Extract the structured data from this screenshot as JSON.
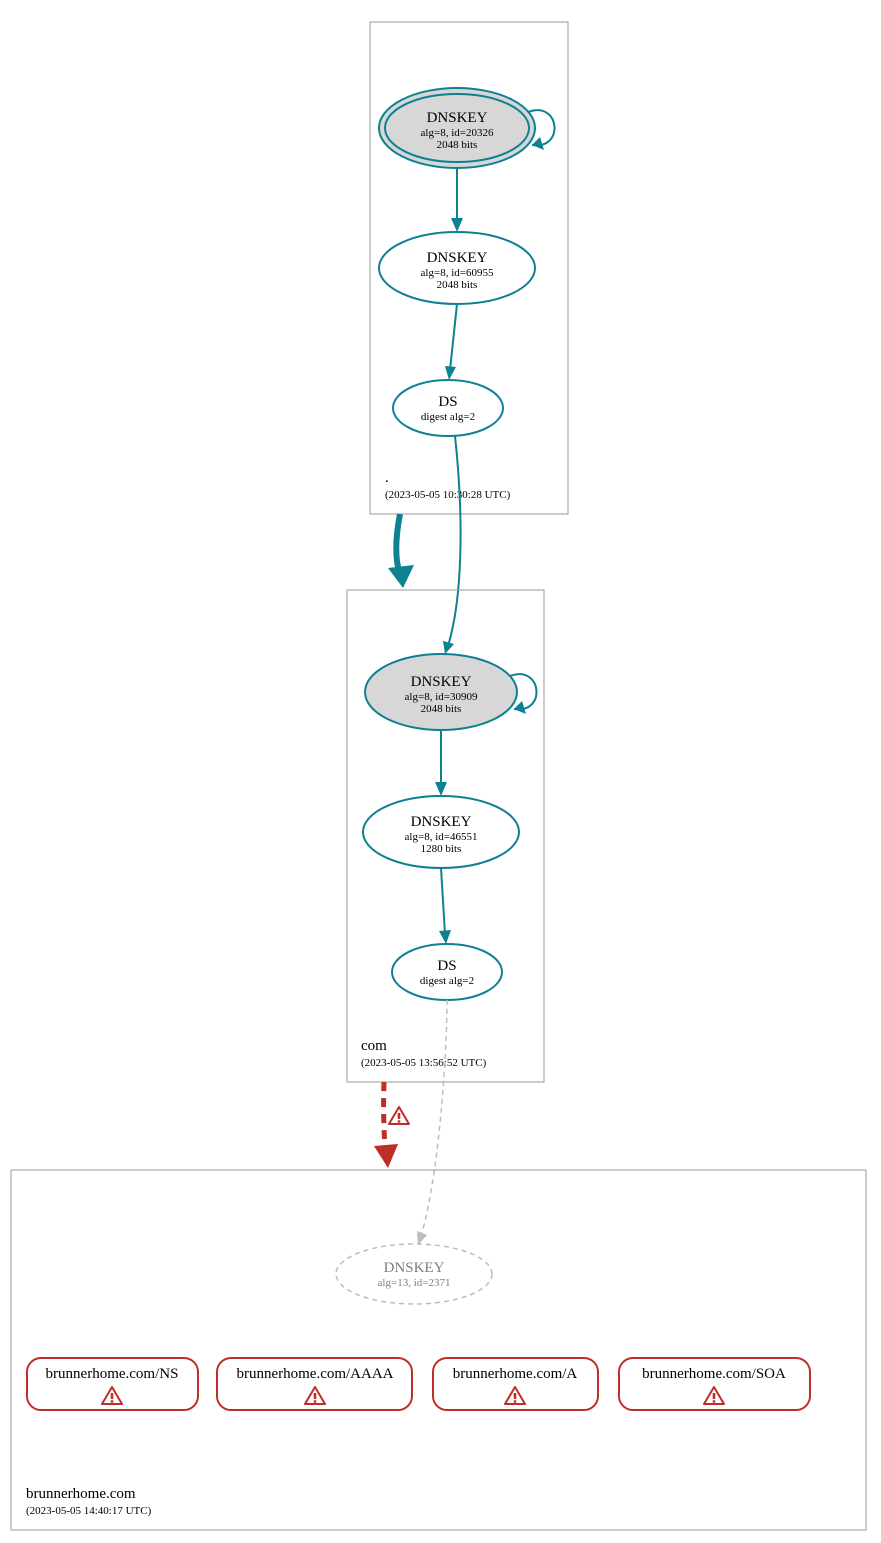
{
  "zones": {
    "root": {
      "label": ".",
      "timestamp": "(2023-05-05 10:30:28 UTC)"
    },
    "com": {
      "label": "com",
      "timestamp": "(2023-05-05 13:56:52 UTC)"
    },
    "leaf": {
      "label": "brunnerhome.com",
      "timestamp": "(2023-05-05 14:40:17 UTC)"
    }
  },
  "nodes": {
    "root_ksk": {
      "title": "DNSKEY",
      "line1": "alg=8, id=20326",
      "line2": "2048 bits"
    },
    "root_zsk": {
      "title": "DNSKEY",
      "line1": "alg=8, id=60955",
      "line2": "2048 bits"
    },
    "root_ds": {
      "title": "DS",
      "line1": "digest alg=2"
    },
    "com_ksk": {
      "title": "DNSKEY",
      "line1": "alg=8, id=30909",
      "line2": "2048 bits"
    },
    "com_zsk": {
      "title": "DNSKEY",
      "line1": "alg=8, id=46551",
      "line2": "1280 bits"
    },
    "com_ds": {
      "title": "DS",
      "line1": "digest alg=2"
    },
    "leaf_key": {
      "title": "DNSKEY",
      "line1": "alg=13, id=2371"
    }
  },
  "rrsets": {
    "ns": {
      "text": "brunnerhome.com/NS"
    },
    "aaaa": {
      "text": "brunnerhome.com/AAAA"
    },
    "a": {
      "text": "brunnerhome.com/A"
    },
    "soa": {
      "text": "brunnerhome.com/SOA"
    }
  },
  "chart_data": {
    "type": "graph",
    "description": "DNSSEC authentication chain (DNSViz-style) from root to brunnerhome.com",
    "zones": [
      {
        "name": ".",
        "queried_at": "2023-05-05 10:30:28 UTC"
      },
      {
        "name": "com",
        "queried_at": "2023-05-05 13:56:52 UTC"
      },
      {
        "name": "brunnerhome.com",
        "queried_at": "2023-05-05 14:40:17 UTC"
      }
    ],
    "nodes": [
      {
        "id": "root_ksk",
        "zone": ".",
        "type": "DNSKEY",
        "alg": 8,
        "key_id": 20326,
        "bits": 2048,
        "sep": true,
        "trust_anchor": true
      },
      {
        "id": "root_zsk",
        "zone": ".",
        "type": "DNSKEY",
        "alg": 8,
        "key_id": 60955,
        "bits": 2048,
        "sep": false
      },
      {
        "id": "root_ds",
        "zone": ".",
        "type": "DS",
        "digest_alg": 2,
        "covers": "com"
      },
      {
        "id": "com_ksk",
        "zone": "com",
        "type": "DNSKEY",
        "alg": 8,
        "key_id": 30909,
        "bits": 2048,
        "sep": true
      },
      {
        "id": "com_zsk",
        "zone": "com",
        "type": "DNSKEY",
        "alg": 8,
        "key_id": 46551,
        "bits": 1280,
        "sep": false
      },
      {
        "id": "com_ds",
        "zone": "com",
        "type": "DS",
        "digest_alg": 2,
        "covers": "brunnerhome.com"
      },
      {
        "id": "leaf_key",
        "zone": "brunnerhome.com",
        "type": "DNSKEY",
        "alg": 13,
        "key_id": 2371,
        "status": "missing"
      },
      {
        "id": "rr_ns",
        "zone": "brunnerhome.com",
        "type": "RRset",
        "name": "brunnerhome.com/NS",
        "status": "error"
      },
      {
        "id": "rr_aaaa",
        "zone": "brunnerhome.com",
        "type": "RRset",
        "name": "brunnerhome.com/AAAA",
        "status": "error"
      },
      {
        "id": "rr_a",
        "zone": "brunnerhome.com",
        "type": "RRset",
        "name": "brunnerhome.com/A",
        "status": "error"
      },
      {
        "id": "rr_soa",
        "zone": "brunnerhome.com",
        "type": "RRset",
        "name": "brunnerhome.com/SOA",
        "status": "error"
      }
    ],
    "edges": [
      {
        "from": "root_ksk",
        "to": "root_ksk",
        "kind": "self-sign",
        "style": "solid"
      },
      {
        "from": "root_ksk",
        "to": "root_zsk",
        "kind": "signs",
        "style": "solid"
      },
      {
        "from": "root_zsk",
        "to": "root_ds",
        "kind": "signs",
        "style": "solid"
      },
      {
        "from": ".",
        "to": "com",
        "kind": "delegation",
        "style": "solid-thick"
      },
      {
        "from": "root_ds",
        "to": "com_ksk",
        "kind": "ds-match",
        "style": "solid"
      },
      {
        "from": "com_ksk",
        "to": "com_ksk",
        "kind": "self-sign",
        "style": "solid"
      },
      {
        "from": "com_ksk",
        "to": "com_zsk",
        "kind": "signs",
        "style": "solid"
      },
      {
        "from": "com_zsk",
        "to": "com_ds",
        "kind": "signs",
        "style": "solid"
      },
      {
        "from": "com",
        "to": "brunnerhome.com",
        "kind": "delegation",
        "style": "dashed-red",
        "status": "error"
      },
      {
        "from": "com_ds",
        "to": "leaf_key",
        "kind": "ds-match",
        "style": "dashed-gray",
        "status": "no-key"
      }
    ]
  }
}
